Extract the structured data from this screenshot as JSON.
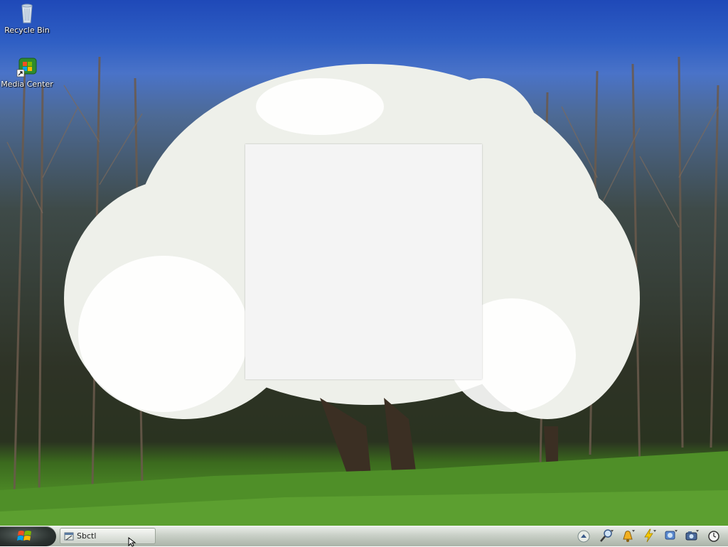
{
  "desktop": {
    "icons": [
      {
        "label": "Recycle Bin",
        "icon": "recycle-bin-icon"
      },
      {
        "label": "Media Center",
        "icon": "media-center-icon"
      }
    ]
  },
  "taskbar": {
    "start_icon": "windows-logo-icon",
    "tasks": [
      {
        "label": "Sbctl",
        "icon": "window-app-icon"
      }
    ],
    "tray_icons": [
      "show-hidden-icons-arrow-icon",
      "magnifier-icon",
      "notification-bell-icon",
      "power-icon",
      "network-icon",
      "camera-icon",
      "clock-icon"
    ]
  },
  "colors": {
    "sky": "#2f5fc4",
    "grass": "#4d8a26",
    "window": "#f4f4f4",
    "taskbar": "#c9d0c7"
  }
}
